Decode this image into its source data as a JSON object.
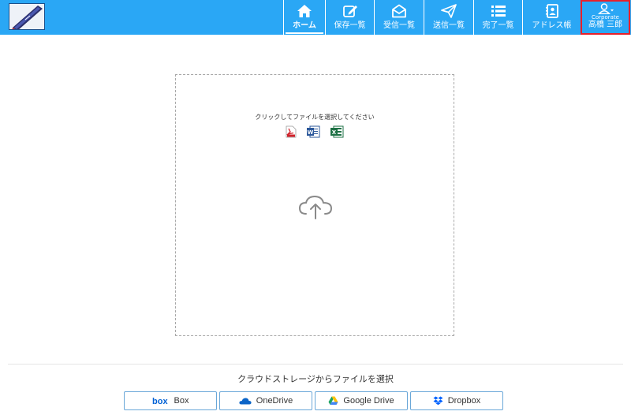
{
  "header": {
    "nav": [
      {
        "id": "home",
        "label": "ホーム",
        "icon": "home-icon",
        "active": true
      },
      {
        "id": "saved",
        "label": "保存一覧",
        "icon": "edit-icon"
      },
      {
        "id": "received",
        "label": "受信一覧",
        "icon": "envelope-open-icon"
      },
      {
        "id": "sent",
        "label": "送信一覧",
        "icon": "paper-plane-icon"
      },
      {
        "id": "completed",
        "label": "完了一覧",
        "icon": "list-icon"
      },
      {
        "id": "addressbook",
        "label": "アドレス帳",
        "icon": "address-book-icon"
      }
    ],
    "user": {
      "company": "Corporate",
      "name": "高橋 三郎",
      "icon": "user-icon"
    }
  },
  "upload": {
    "instruction": "クリックしてファイルを選択してください",
    "file_types": [
      "pdf",
      "word",
      "excel"
    ]
  },
  "cloud_storage": {
    "title": "クラウドストレージからファイルを選択",
    "buttons": [
      {
        "label": "Box",
        "icon": "box-logo-icon"
      },
      {
        "label": "OneDrive",
        "icon": "onedrive-icon"
      },
      {
        "label": "Google Drive",
        "icon": "google-drive-icon"
      },
      {
        "label": "Dropbox",
        "icon": "dropbox-icon"
      }
    ]
  },
  "colors": {
    "header": "#2aa7f5",
    "highlight_border": "#e8202a",
    "button_border": "#6aa7d8"
  }
}
